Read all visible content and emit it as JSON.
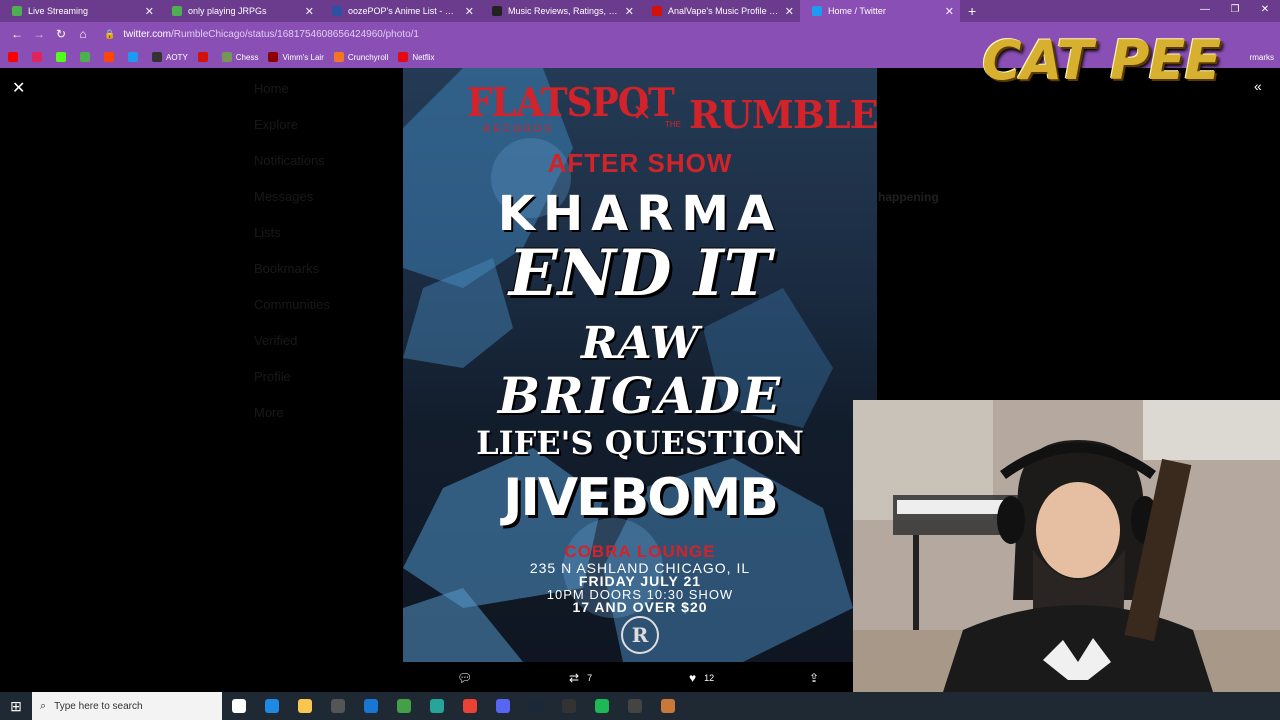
{
  "browser": {
    "tabs": [
      {
        "title": "Live Streaming",
        "favicon_color": "#4caf50",
        "active": false
      },
      {
        "title": "only playing JRPGs",
        "favicon_color": "#4caf50",
        "active": false
      },
      {
        "title": "oozePOP's Anime List - MyAnime",
        "favicon_color": "#2e51a2",
        "active": false
      },
      {
        "title": "Music Reviews, Ratings, Charts, N",
        "favicon_color": "#222222",
        "active": false
      },
      {
        "title": "AnalVape's Music Profile | Last.fm",
        "favicon_color": "#d51007",
        "active": false
      },
      {
        "title": "Home / Twitter",
        "favicon_color": "#1d9bf0",
        "active": true
      }
    ],
    "url_host": "twitter.com",
    "url_path": "/RumbleChicago/status/1681754608656424960/photo/1",
    "bookmarks": [
      {
        "label": "",
        "color": "#ff0000"
      },
      {
        "label": "",
        "color": "#e0245e"
      },
      {
        "label": "",
        "color": "#53fc18"
      },
      {
        "label": "",
        "color": "#4caf50"
      },
      {
        "label": "",
        "color": "#ff4500"
      },
      {
        "label": "",
        "color": "#1d9bf0"
      },
      {
        "label": "AOTY",
        "color": "#333333"
      },
      {
        "label": "",
        "color": "#d51007"
      },
      {
        "label": "Chess",
        "color": "#769656"
      },
      {
        "label": "Vimm's Lair",
        "color": "#8b0000"
      },
      {
        "label": "Crunchyroll",
        "color": "#f47521"
      },
      {
        "label": "Netflix",
        "color": "#e50914"
      }
    ],
    "bookmarks_right": "rmarks"
  },
  "overlay": {
    "logo_text": "CAT PEE"
  },
  "background_twitter": {
    "nav": [
      "Home",
      "Explore",
      "Notifications",
      "Messages",
      "Lists",
      "Bookmarks",
      "Communities",
      "Verified",
      "Profile",
      "More"
    ],
    "right_heading": "happening"
  },
  "poster": {
    "flatspot": "FLATSPOT",
    "records": "RECORDS",
    "x": "×",
    "the": "THE",
    "rumble": "RUMBLE",
    "after_show": "AFTER SHOW",
    "band1": "KHARMA",
    "band2": "END IT",
    "band3": "RAW",
    "band4": "BRIGADE",
    "band5": "LIFE'S QUESTION",
    "band6": "JIVEBOMB",
    "venue": "COBRA LOUNGE",
    "address": "235 N ASHLAND CHICAGO, IL",
    "date": "FRIDAY JULY 21",
    "times": "10PM DOORS 10:30 SHOW",
    "age_price": "17 AND OVER $20",
    "logo_letter": "R"
  },
  "tweet_actions": {
    "retweets": "7",
    "likes": "12"
  },
  "taskbar": {
    "search_placeholder": "Type here to search",
    "icons": [
      "task-view",
      "edge",
      "file-explorer",
      "store",
      "mail",
      "app-green",
      "app-teal",
      "chrome",
      "discord",
      "steam",
      "epic",
      "spotify",
      "app-dark",
      "app-photo"
    ]
  }
}
